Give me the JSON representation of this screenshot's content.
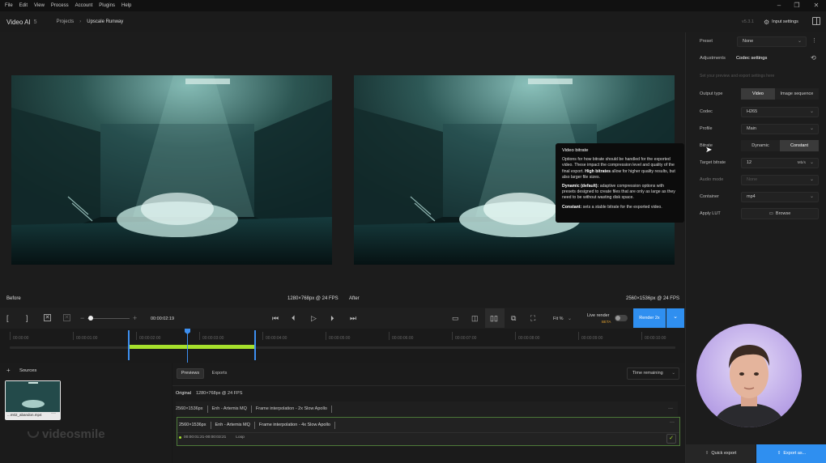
{
  "menu": [
    "File",
    "Edit",
    "View",
    "Process",
    "Account",
    "Plugins",
    "Help"
  ],
  "header": {
    "app_name": "Video AI",
    "app_version": "5",
    "breadcrumb_root": "Projects",
    "breadcrumb_current": "Upscale Runway",
    "version": "v5.3.1",
    "input_settings": "Input settings"
  },
  "viewer": {
    "before_label": "Before",
    "before_res": "1280×768px @ 24 FPS",
    "after_label": "After",
    "after_res": "2560×1536px @ 24 FPS"
  },
  "timeline": {
    "timecode": "00:00:02:19",
    "fit_label": "Fit %",
    "live_render": "Live render",
    "beta": "BETA",
    "render_button": "Render 2x",
    "ticks": [
      "00:00:00",
      "00:00:01:00",
      "00:00:02:00",
      "00:00:03:00",
      "00:00:04:00",
      "00:00:05:00",
      "00:00:06:00",
      "00:00:07:00",
      "00:00:08:00",
      "00:00:09:00",
      "00:00:10:00"
    ]
  },
  "sources": {
    "title": "Sources",
    "file_name": "...m02_abandon.mp4"
  },
  "queue": {
    "tabs": [
      "Previews",
      "Exports"
    ],
    "sort": "Time remaining",
    "original_label": "Original",
    "original_res": "1280×768px @ 24 FPS",
    "rows": [
      {
        "res": "2560×1536px",
        "enh": "Enh - Artemis MQ",
        "fi": "Frame interpolation - 2x Slow Apollo"
      },
      {
        "res": "2560×1536px",
        "enh": "Enh - Artemis MQ",
        "fi": "Frame interpolation - 4x Slow Apollo",
        "range": "00:00:01:21-00:00:03:21",
        "loop": "Loop"
      }
    ]
  },
  "panel": {
    "preset_label": "Preset",
    "preset_value": "None",
    "tab_adjustments": "Adjustments",
    "tab_codec": "Codec settings",
    "hint": "Set your preview and export settings here",
    "output_type_label": "Output type",
    "output_video": "Video",
    "output_image_seq": "Image sequence",
    "codec_label": "Codec",
    "codec_value": "H265",
    "profile_label": "Profile",
    "profile_value": "Main",
    "bitrate_label": "Bitrate",
    "bitrate_dynamic": "Dynamic",
    "bitrate_constant": "Constant",
    "target_label": "Target bitrate",
    "target_value": "12",
    "target_unit": "Mb/s",
    "audio_label": "Audio mode",
    "audio_value": "None",
    "container_label": "Container",
    "container_value": "mp4",
    "lut_label": "Apply LUT",
    "lut_button": "Browse",
    "quick_export": "Quick export",
    "export_as": "Export as..."
  },
  "tooltip": {
    "title": "Video bitrate",
    "p1a": "Options for how bitrate should be handled for the exported video. These impact the compression level and quality of the final export. ",
    "p1b": "High bitrates",
    "p1c": " allow for higher quality results, but also larger file sizes.",
    "p2a": "Dynamic (default):",
    "p2b": " adaptive compression options with presets designed to create files that are only as large as they need to be without wasting disk space.",
    "p3a": "Constant:",
    "p3b": " sets a stable bitrate for the exported video."
  },
  "watermark": "videosmile",
  "colors": {
    "accent": "#2f8ff0",
    "clip": "#a6e02c",
    "playhead": "#3d8ff0"
  }
}
